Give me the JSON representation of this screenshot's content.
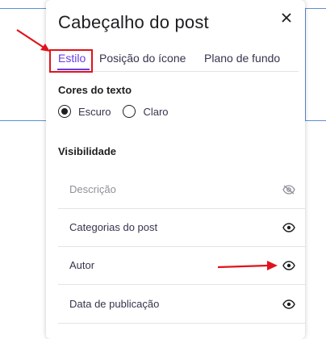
{
  "dialog": {
    "title": "Cabeçalho do post",
    "close_icon": "close-icon"
  },
  "tabs": [
    {
      "label": "Estilo",
      "active": true
    },
    {
      "label": "Posição do ícone",
      "active": false
    },
    {
      "label": "Plano de fundo",
      "active": false
    }
  ],
  "text_colors": {
    "heading": "Cores do texto",
    "options": [
      {
        "label": "Escuro",
        "checked": true
      },
      {
        "label": "Claro",
        "checked": false
      }
    ]
  },
  "visibility": {
    "heading": "Visibilidade",
    "items": [
      {
        "label": "Descrição",
        "visible": false,
        "icon": "eye-off-icon"
      },
      {
        "label": "Categorias do post",
        "visible": true,
        "icon": "eye-icon"
      },
      {
        "label": "Autor",
        "visible": true,
        "icon": "eye-icon"
      },
      {
        "label": "Data de publicação",
        "visible": true,
        "icon": "eye-icon"
      }
    ]
  },
  "colors": {
    "accent": "#673de6",
    "annotation": "#e0131c",
    "text": "#1d1e20"
  }
}
